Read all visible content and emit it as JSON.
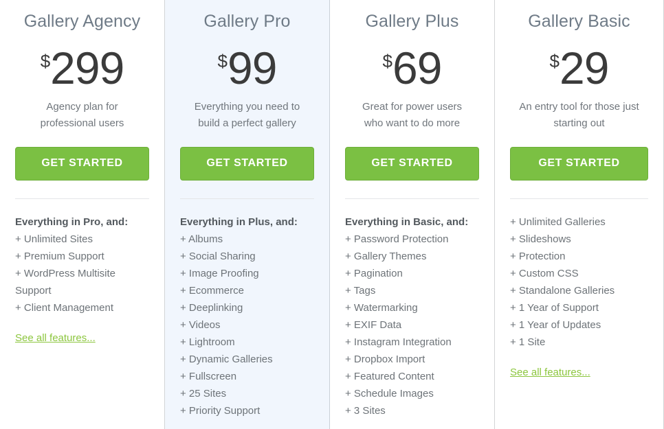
{
  "theme": {
    "cta_green": "#7bc043",
    "link_green": "#8cc63e",
    "featured_background": "#f1f6fd",
    "divider_color": "#d2d4d6",
    "title_color": "#6f7b87",
    "price_color": "#3b3b3b",
    "feature_color": "#6d7378"
  },
  "plans": [
    {
      "name": "Gallery Agency",
      "currency": "$",
      "price": "299",
      "description": "Agency plan for professional users",
      "cta_label": "GET STARTED",
      "featured": false,
      "features_heading": "Everything in Pro, and:",
      "features": [
        "+ Unlimited Sites",
        "+ Premium Support",
        "+ WordPress Multisite Support",
        "+ Client Management"
      ],
      "see_all_label": "See all features..."
    },
    {
      "name": "Gallery Pro",
      "currency": "$",
      "price": "99",
      "description": "Everything you need to build a perfect gallery",
      "cta_label": "GET STARTED",
      "featured": true,
      "features_heading": "Everything in Plus, and:",
      "features": [
        "+ Albums",
        "+ Social Sharing",
        "+ Image Proofing",
        "+ Ecommerce",
        "+ Deeplinking",
        "+ Videos",
        "+ Lightroom",
        "+ Dynamic Galleries",
        "+ Fullscreen",
        "+ 25 Sites",
        "+ Priority Support"
      ],
      "see_all_label": ""
    },
    {
      "name": "Gallery Plus",
      "currency": "$",
      "price": "69",
      "description": "Great for power users who want to do more",
      "cta_label": "GET STARTED",
      "featured": false,
      "features_heading": "Everything in Basic, and:",
      "features": [
        "+ Password Protection",
        "+ Gallery Themes",
        "+ Pagination",
        "+ Tags",
        "+ Watermarking",
        "+ EXIF Data",
        "+ Instagram Integration",
        "+ Dropbox Import",
        "+ Featured Content",
        "+ Schedule Images",
        "+ 3 Sites"
      ],
      "see_all_label": ""
    },
    {
      "name": "Gallery Basic",
      "currency": "$",
      "price": "29",
      "description": "An entry tool for those just starting out",
      "cta_label": "GET STARTED",
      "featured": false,
      "features_heading": "",
      "features": [
        "+ Unlimited Galleries",
        "+ Slideshows",
        "+ Protection",
        "+ Custom CSS",
        "+ Standalone Galleries",
        "+ 1 Year of Support",
        "+ 1 Year of Updates",
        "+ 1 Site"
      ],
      "see_all_label": "See all features..."
    }
  ]
}
